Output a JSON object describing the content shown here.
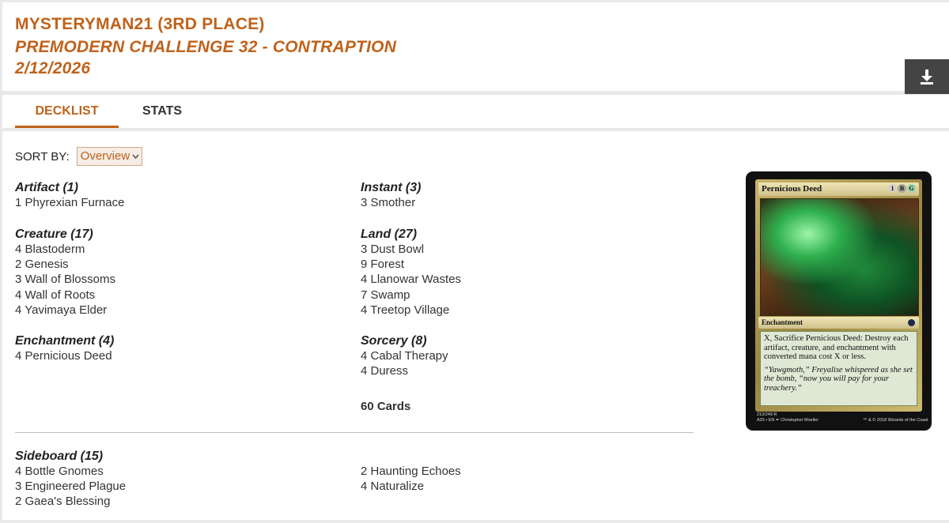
{
  "header": {
    "player": "MYSTERYMAN21 (3RD PLACE)",
    "event": "PREMODERN CHALLENGE 32 - CONTRAPTION",
    "date": "2/12/2026",
    "download_icon": "download-icon"
  },
  "tabs": [
    {
      "label": "DECKLIST",
      "active": true
    },
    {
      "label": "STATS",
      "active": false
    }
  ],
  "sort": {
    "label": "SORT BY:",
    "value": "Overview"
  },
  "groups": {
    "artifact": {
      "title": "Artifact (1)",
      "items": [
        "1 Phyrexian Furnace"
      ]
    },
    "creature": {
      "title": "Creature (17)",
      "items": [
        "4 Blastoderm",
        "2 Genesis",
        "3 Wall of Blossoms",
        "4 Wall of Roots",
        "4 Yavimaya Elder"
      ]
    },
    "enchantment": {
      "title": "Enchantment (4)",
      "items": [
        "4 Pernicious Deed"
      ]
    },
    "instant": {
      "title": "Instant (3)",
      "items": [
        "3 Smother"
      ]
    },
    "land": {
      "title": "Land (27)",
      "items": [
        "3 Dust Bowl",
        "9 Forest",
        "4 Llanowar Wastes",
        "7 Swamp",
        "4 Treetop Village"
      ]
    },
    "sorcery": {
      "title": "Sorcery (8)",
      "items": [
        "4 Cabal Therapy",
        "4 Duress"
      ]
    }
  },
  "total": "60 Cards",
  "sideboard": {
    "title": "Sideboard (15)",
    "col1": [
      "4 Bottle Gnomes",
      "3 Engineered Plague",
      "2 Gaea's Blessing"
    ],
    "col2": [
      "2 Haunting Echoes",
      "4 Naturalize"
    ]
  },
  "card": {
    "name": "Pernicious Deed",
    "mana": [
      "1",
      "B",
      "G"
    ],
    "type": "Enchantment",
    "rules": "X, Sacrifice Pernicious Deed: Destroy each artifact, creature, and enchantment with converted mana cost X or less.",
    "flavor": "“Yawgmoth,” Freyalise whispered as she set the bomb, “now you will pay for your treachery.”",
    "footer1": "212/249 R",
    "footer2": "A25 • EN ✒ Christopher Moeller",
    "copyright": "™ & © 2018 Wizards of the Coast"
  }
}
